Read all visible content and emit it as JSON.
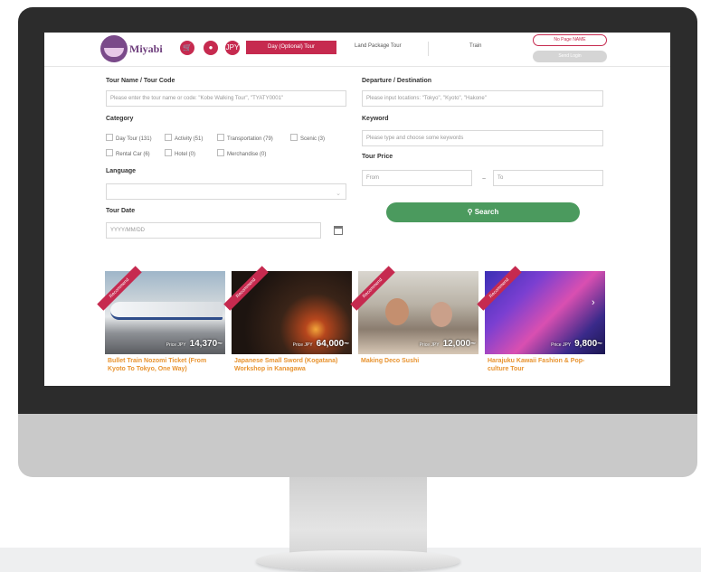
{
  "header": {
    "logo_text": "Miyabi",
    "icons": [
      "cart-icon",
      "globe-icon",
      "jpy-icon"
    ],
    "currency": "JPY",
    "button_label": "Day (Optional) Tour",
    "links": [
      "Land Package Tour",
      "Train"
    ],
    "pill_top": "No Page NAME",
    "pill_bottom": "Send Login"
  },
  "form": {
    "tour_name_label": "Tour Name / Tour Code",
    "tour_name_placeholder": "Please enter the tour name or code: \"Kobe Walking Tour\", \"TYATY0001\"",
    "departure_label": "Departure / Destination",
    "departure_placeholder": "Please input locations: \"Tokyo\", \"Kyoto\", \"Hakone\"",
    "category_label": "Category",
    "categories": [
      "Day Tour (131)",
      "Activity (51)",
      "Transportation (79)",
      "Scenic (3)",
      "Rental Car (6)",
      "Hotel (0)",
      "Merchandise (0)"
    ],
    "keyword_label": "Keyword",
    "keyword_placeholder": "Please type and choose some keywords",
    "price_label": "Tour Price",
    "price_from": "From",
    "price_tilde": "~",
    "price_to": "To",
    "language_label": "Language",
    "tour_date_label": "Tour Date",
    "tour_date_placeholder": "YYYY/MM/DD",
    "search_label": "Search",
    "search_icon": "search-icon"
  },
  "cards": [
    {
      "ribbon": "Recommend",
      "currency": "Price JPY",
      "price": "14,370~",
      "title": "Bullet Train Nozomi Ticket (From Kyoto To Tokyo, One Way)"
    },
    {
      "ribbon": "Recommend",
      "currency": "Price JPY",
      "price": "64,000~",
      "title": "Japanese Small Sword (Kogatana) Workshop in Kanagawa"
    },
    {
      "ribbon": "Recommend",
      "currency": "Price JPY",
      "price": "12,000~",
      "title": "Making Deco Sushi"
    },
    {
      "ribbon": "Recommend",
      "currency": "Price JPY",
      "price": "9,800~",
      "title": "Harajuku Kawaii Fashion & Pop-culture Tour"
    }
  ],
  "colors": {
    "brand": "#c62a4f",
    "search": "#4b9a5e",
    "card_title": "#e8932f",
    "bezel": "#2c2c2c",
    "chin": "#c9c9c9"
  }
}
